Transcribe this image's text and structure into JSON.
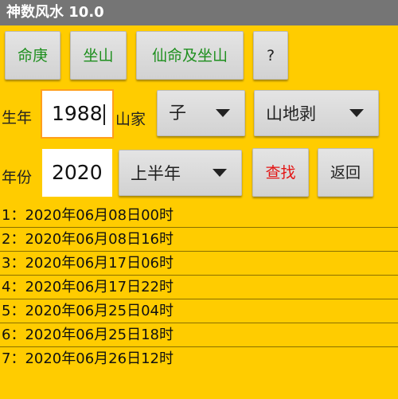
{
  "app": {
    "title": "神数风水 10.0"
  },
  "buttons": {
    "ming_geng": "命庚",
    "zuo_shan": "坐山",
    "xian_ming_zuo_shan": "仙命及坐山",
    "help": "?",
    "search": "查找",
    "back": "返回"
  },
  "form": {
    "birth_year_label": "生年",
    "birth_year_value": "1988",
    "mountain_house_label": "山家",
    "branch_select": "子",
    "hexagram_select": "山地剥",
    "year_label": "年份",
    "year_value": "2020",
    "half_select": "上半年"
  },
  "results": [
    "1：2020年06月08日00时",
    "2：2020年06月08日16时",
    "3：2020年06月17日06时",
    "4：2020年06月17日22时",
    "5：2020年06月25日04时",
    "6：2020年06月25日18时",
    "7：2020年06月26日12时"
  ],
  "colors": {
    "background": "#FFCC00",
    "titlebar": "#757575",
    "green_text": "#1E8F1E",
    "red_text": "#E31414",
    "focus_border": "#FF9F1C"
  }
}
